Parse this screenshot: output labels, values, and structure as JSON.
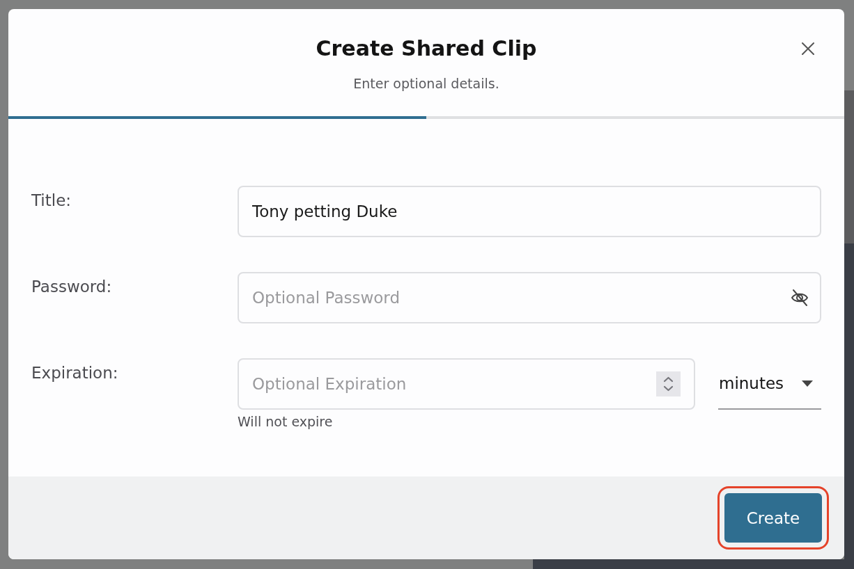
{
  "dialog": {
    "title": "Create Shared Clip",
    "subtitle": "Enter optional details.",
    "progress": {
      "level": 0.5
    }
  },
  "fields": [
    {
      "kind": "text",
      "label": "Title:",
      "value": "Tony petting Duke"
    },
    {
      "kind": "password",
      "label": "Password:",
      "placeholder": "Optional Password"
    },
    {
      "kind": "number",
      "label": "Expiration:",
      "placeholder": "Optional Expiration",
      "unit": "minutes",
      "hint": "Will not expire"
    }
  ],
  "create_button": {
    "label": "Create",
    "highlighted": true
  }
}
